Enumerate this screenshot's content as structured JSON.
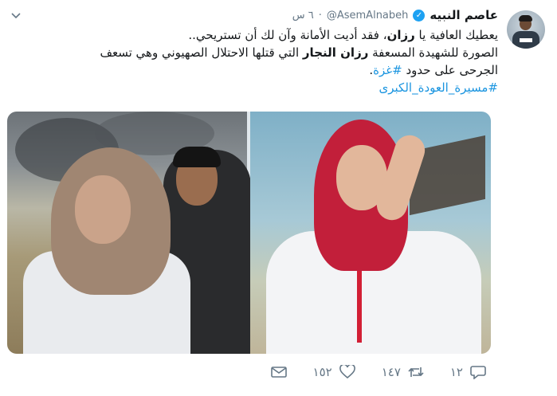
{
  "header": {
    "author_name": "عاصم النبيه",
    "handle": "@AsemAlnabeh",
    "separator": "·",
    "time": "٦ س",
    "verified": true
  },
  "tweet": {
    "line1_pre": "يعطيك العافية يا ",
    "line1_bold": "رزان",
    "line1_post": "، فقد أديت الأمانة وآن لك أن تستريحي..",
    "line2_pre": "الصورة للشهيدة المسعفة ",
    "line2_bold": "رزان النجار",
    "line2_post": " التي قتلها الاحتلال الصهيوني وهي تسعف",
    "line3_pre": "الجرحى على حدود ",
    "line3_hashtag": "#غزة",
    "line3_post": ".",
    "hashtag2": "#مسيرة_العودة_الكبرى"
  },
  "actions": {
    "reply_count": "١٢",
    "retweet_count": "١٤٧",
    "like_count": "١٥٢"
  },
  "icons": {
    "caret": "chevron-down-icon",
    "verified": "verified-badge-icon",
    "reply": "reply-icon",
    "retweet": "retweet-icon",
    "like": "heart-icon",
    "dm": "envelope-icon"
  },
  "colors": {
    "link": "#1b95e0",
    "verified": "#1da1f2",
    "muted": "#657786",
    "text": "#14171a"
  }
}
